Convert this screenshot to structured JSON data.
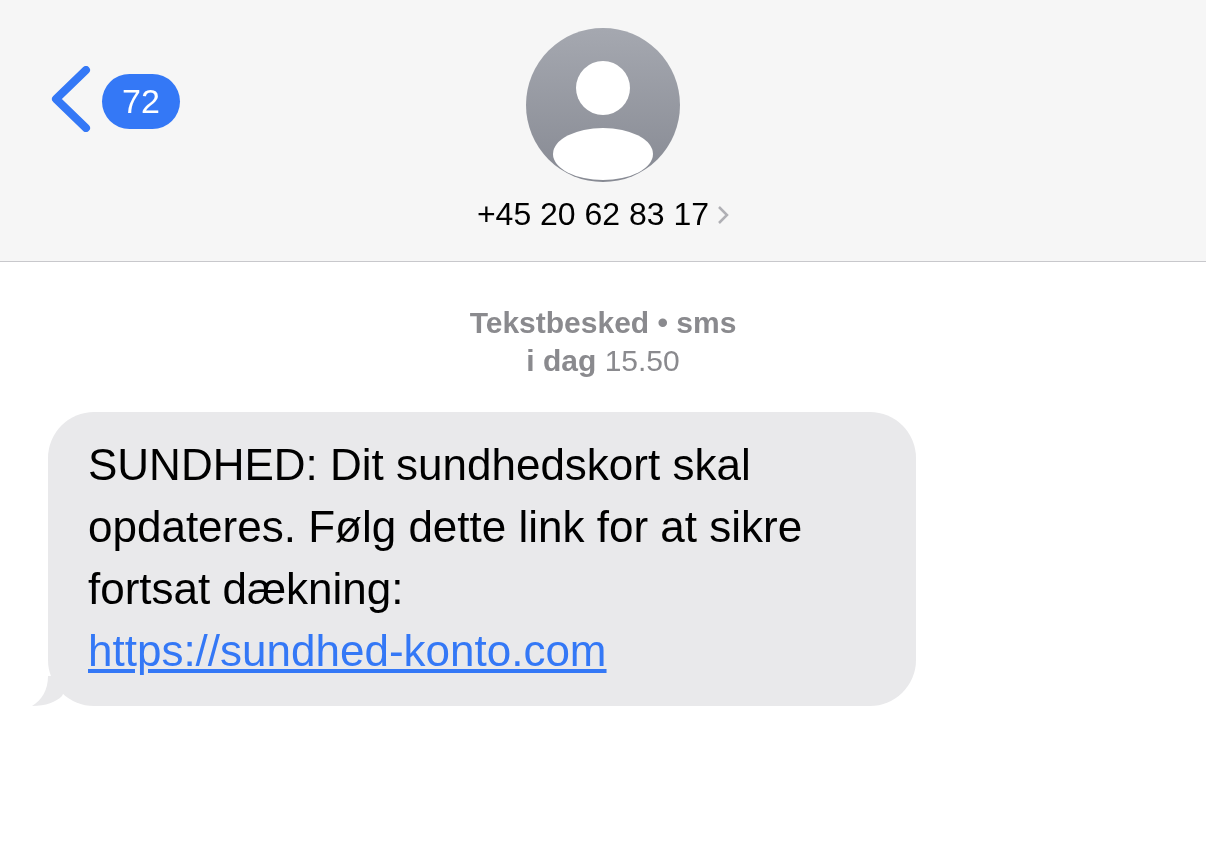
{
  "header": {
    "back_badge": "72",
    "contact": "+45 20 62 83 17"
  },
  "meta": {
    "service": "Tekstbesked • sms",
    "time": "**i dag** 15.50"
  },
  "messages": [
    {
      "kind": "incoming",
      "text": "SUNDHED: Dit sundhedskort skal opdateres. Følg dette link for at sikre fortsat dækning: ",
      "link": "https://sundhed-konto.com"
    }
  ]
}
